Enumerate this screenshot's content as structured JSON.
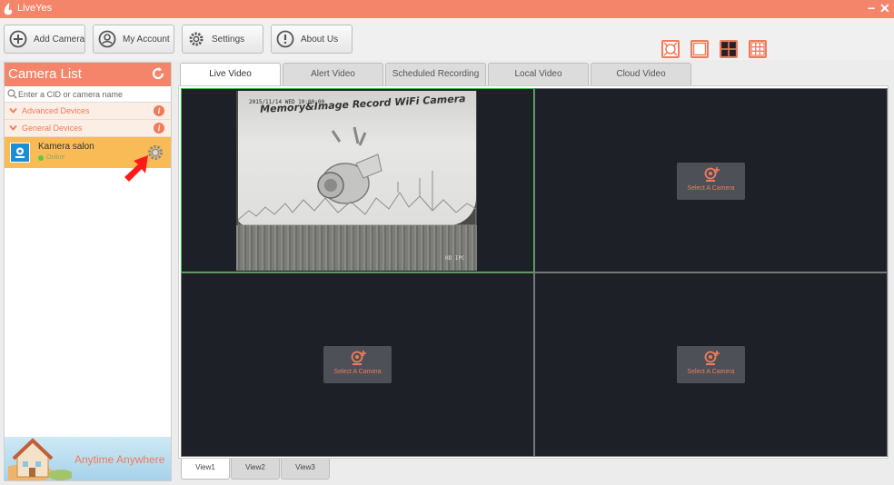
{
  "titlebar": {
    "title": "LiveYes",
    "minimize": "−",
    "close": "✕"
  },
  "toolbar": {
    "add_camera": "Add Camera",
    "my_account": "My Account",
    "settings": "Settings",
    "about_us": "About Us"
  },
  "layout_buttons": [
    "fullscreen-icon",
    "single-view-icon",
    "quad-view-icon",
    "nine-view-icon"
  ],
  "camera_list": {
    "title": "Camera List",
    "search_placeholder": "Enter a CID or camera name",
    "groups": [
      {
        "label": "Advanced Devices",
        "info": "i"
      },
      {
        "label": "General Devices",
        "info": "i"
      }
    ],
    "devices": [
      {
        "name": "Kamera salon",
        "status": "Online"
      }
    ]
  },
  "banner": {
    "slogan": "Anytime Anywhere"
  },
  "tabs": [
    "Live Video",
    "Alert Video",
    "Scheduled Recording",
    "Local Video",
    "Cloud Video"
  ],
  "active_tab": "Live Video",
  "video": {
    "feed_timestamp": "2015/11/14 WED 10:00:00",
    "feed_headline": "Memory&Image Record WiFi Camera",
    "feed_watermark": "HD IPC",
    "select_camera_label": "Select A Camera"
  },
  "view_tabs": [
    "View1",
    "View2",
    "View3"
  ],
  "colors": {
    "accent": "#f4856a",
    "selected_device": "#f9bb55",
    "video_bg": "#1d2027",
    "active_pane": "#3fc14a"
  }
}
